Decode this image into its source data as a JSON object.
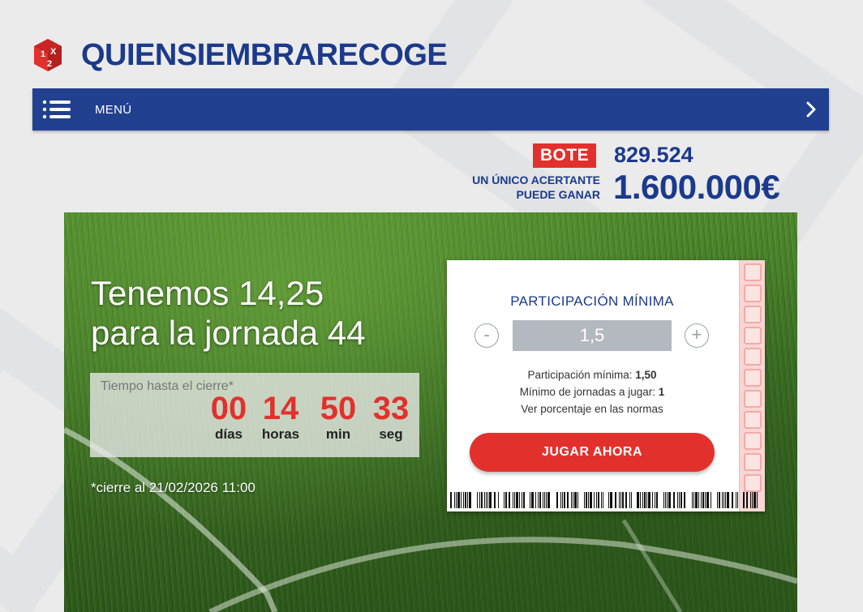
{
  "brand": {
    "name": "QUIENSIEMBRARECOGE",
    "logo_marks": [
      "1",
      "X",
      "2"
    ],
    "primary_color": "#1b3a8c",
    "accent_color": "#e2312d"
  },
  "menu": {
    "label": "MENÚ",
    "icon": "hamburger-icon",
    "chevron": "chevron-right-icon"
  },
  "jackpot": {
    "tag": "BOTE",
    "amount": "829.524",
    "winner_line1": "UN ÚNICO ACERTANTE",
    "winner_line2": "PUEDE GANAR",
    "prize": "1.600.000€"
  },
  "hero": {
    "headline_line1": "Tenemos 14,25",
    "headline_line2": "para la jornada 44",
    "countdown": {
      "label": "Tiempo hasta el cierre*",
      "units": [
        {
          "value": "00",
          "label": "días"
        },
        {
          "value": "14",
          "label": "horas"
        },
        {
          "value": "50",
          "label": "min"
        },
        {
          "value": "33",
          "label": "seg"
        }
      ]
    },
    "closing_note": "*cierre al 21/02/2026 11:00"
  },
  "ticket": {
    "title": "PARTICIPACIÓN MÍNIMA",
    "minus": "-",
    "plus": "+",
    "value": "1,5",
    "min_participation_label": "Participación mínima: ",
    "min_participation_value": "1,50",
    "min_rounds_label": "Mínimo de jornadas a jugar: ",
    "min_rounds_value": "1",
    "rules_link": "Ver porcentaje en las normas",
    "play_button": "JUGAR AHORA"
  }
}
